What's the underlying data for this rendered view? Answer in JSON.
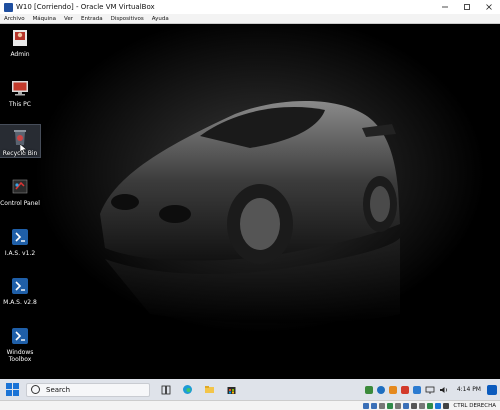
{
  "window": {
    "title": "W10 [Corriendo] - Oracle VM VirtualBox"
  },
  "menu": [
    "Archivo",
    "Máquina",
    "Ver",
    "Entrada",
    "Dispositivos",
    "Ayuda"
  ],
  "desktop_icons": [
    {
      "label": "Admin",
      "icon": "user-folder-icon"
    },
    {
      "label": "This PC",
      "icon": "computer-icon"
    },
    {
      "label": "Recycle Bin",
      "icon": "recycle-bin-icon"
    },
    {
      "label": "Control Panel",
      "icon": "control-panel-icon"
    },
    {
      "label": "I.A.S. v1.2",
      "icon": "powershell-script-icon"
    },
    {
      "label": "M.A.S. v2.8",
      "icon": "powershell-script-icon"
    },
    {
      "label": "Windows Toolbox",
      "icon": "powershell-script-icon"
    }
  ],
  "taskbar": {
    "search_placeholder": "Search",
    "clock": "4:14 PM"
  },
  "statusbar": {
    "host_key": "CTRL DERECHA"
  },
  "colors": {
    "accent": "#1a73d6",
    "taskbar_bg": "#dfe3ea"
  }
}
